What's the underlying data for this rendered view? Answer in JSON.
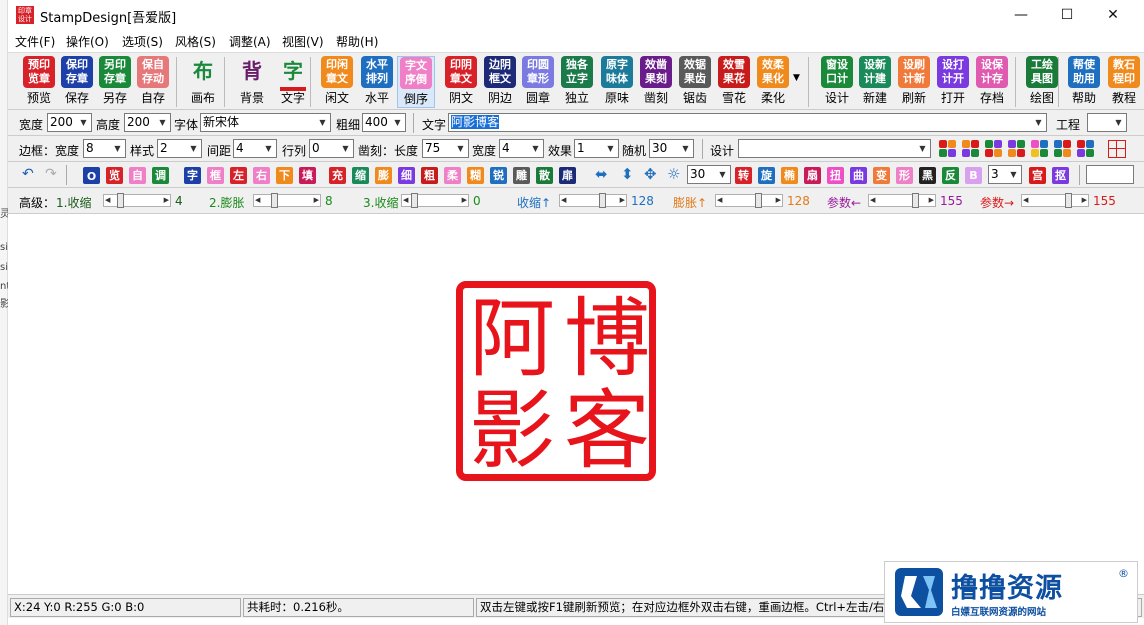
{
  "title": "StampDesign[吾爱版]",
  "icon_text": "印章设计",
  "window": {
    "minimize": "—",
    "maximize": "☐",
    "close": "✕"
  },
  "menu": [
    "文件(F)",
    "操作(O)",
    "选项(S)",
    "风格(S)",
    "调整(A)",
    "视图(V)",
    "帮助(H)"
  ],
  "toolbar": [
    {
      "icon": "预印览章",
      "label": "预览",
      "color": "#d8222a"
    },
    {
      "icon": "保印存章",
      "label": "保存",
      "color": "#1c3fa8"
    },
    {
      "icon": "另印存章",
      "label": "另存",
      "color": "#1a8a3a"
    },
    {
      "icon": "保自存动",
      "label": "自存",
      "color": "#e7787a"
    },
    {
      "icon": "布",
      "label": "画布",
      "color": "#f0f0f0"
    },
    {
      "icon": "背",
      "label": "背景",
      "color": "#f0f0f0"
    },
    {
      "icon": "字",
      "label": "文字",
      "color": "#f0f0f0"
    },
    {
      "icon": "印闲章文",
      "label": "闲文",
      "color": "#f08a1c"
    },
    {
      "icon": "水平排列",
      "label": "水平",
      "color": "#1f6fc0"
    },
    {
      "icon": "字文序倒",
      "label": "倒序",
      "color": "#ef7fc6"
    },
    {
      "icon": "印阴章文",
      "label": "阴文",
      "color": "#d8222a"
    },
    {
      "icon": "边阴框文",
      "label": "阴边",
      "color": "#1c2a78"
    },
    {
      "icon": "印圆章形",
      "label": "圆章",
      "color": "#7a7ae0"
    },
    {
      "icon": "独各立字",
      "label": "独立",
      "color": "#1a7a4a"
    },
    {
      "icon": "原字味体",
      "label": "原味",
      "color": "#1c7b9a"
    },
    {
      "icon": "效凿果刻",
      "label": "凿刻",
      "color": "#6a1c8a"
    },
    {
      "icon": "效锯果齿",
      "label": "锯齿",
      "color": "#5a5a5a"
    },
    {
      "icon": "效雪果花",
      "label": "雪花",
      "color": "#c81c1c"
    },
    {
      "icon": "效柔果化",
      "label": "柔化",
      "color": "#f08a1c"
    },
    {
      "icon": "窗设口计",
      "label": "设计",
      "color": "#1a8a3a"
    },
    {
      "icon": "设新计建",
      "label": "新建",
      "color": "#1a8a5a"
    },
    {
      "icon": "设刷计新",
      "label": "刷新",
      "color": "#f07a3a"
    },
    {
      "icon": "设打计开",
      "label": "打开",
      "color": "#7a3ae0"
    },
    {
      "icon": "设保计存",
      "label": "存档",
      "color": "#e05ab0"
    },
    {
      "icon": "工绘具图",
      "label": "绘图",
      "color": "#1a7a3a"
    },
    {
      "icon": "帮使助用",
      "label": "帮助",
      "color": "#1f6fc0"
    },
    {
      "icon": "教石程印",
      "label": "教程",
      "color": "#f08a1c"
    }
  ],
  "row1": {
    "width_label": "宽度",
    "width": "200",
    "height_label": "高度",
    "height": "200",
    "font_label": "字体",
    "font": "新宋体",
    "weight_label": "粗细",
    "weight": "400",
    "text_label": "文字",
    "text": "阿影博客",
    "project_label": "工程",
    "project": ""
  },
  "row2": {
    "border_label": "边框：宽度",
    "border_width": "8",
    "style_label": "样式",
    "style": "2",
    "spacing_label": "间距",
    "spacing": "4",
    "rowcol_label": "行列",
    "rowcol": "0",
    "carve_label": "凿刻：长度",
    "carve_len": "75",
    "carve_w_label": "宽度",
    "carve_w": "4",
    "effect_label": "效果",
    "effect": "1",
    "random_label": "随机",
    "random": "30",
    "design_label": "设计",
    "design": ""
  },
  "row3": {
    "squares": [
      {
        "t": "O",
        "c": "#1c3fa8"
      },
      {
        "t": "览",
        "c": "#d8222a"
      },
      {
        "t": "自",
        "c": "#ef7fc6"
      },
      {
        "t": "调",
        "c": "#1a8a3a"
      },
      {
        "t": "字",
        "c": "#1c3fa8"
      },
      {
        "t": "框",
        "c": "#ef7fc6"
      },
      {
        "t": "左",
        "c": "#d8222a"
      },
      {
        "t": "右",
        "c": "#ef7fc6"
      },
      {
        "t": "下",
        "c": "#f08a1c"
      },
      {
        "t": "填",
        "c": "#c81c5a"
      },
      {
        "t": "充",
        "c": "#d8222a"
      },
      {
        "t": "缩",
        "c": "#1a8a5a"
      },
      {
        "t": "膨",
        "c": "#f08a1c"
      },
      {
        "t": "细",
        "c": "#7a3ae0"
      },
      {
        "t": "粗",
        "c": "#c81c1c"
      },
      {
        "t": "柔",
        "c": "#ef7fc6"
      },
      {
        "t": "糊",
        "c": "#f08a1c"
      },
      {
        "t": "锐",
        "c": "#1f6fc0"
      },
      {
        "t": "雕",
        "c": "#5a5a5a"
      },
      {
        "t": "散",
        "c": "#1a7a3a"
      },
      {
        "t": "扉",
        "c": "#1c2a78"
      }
    ],
    "value": "30",
    "squares2": [
      {
        "t": "转",
        "c": "#d8222a"
      },
      {
        "t": "旋",
        "c": "#1f6fc0"
      },
      {
        "t": "椭",
        "c": "#f08a1c"
      },
      {
        "t": "扇",
        "c": "#c81c5a"
      },
      {
        "t": "扭",
        "c": "#ef4fc6"
      },
      {
        "t": "曲",
        "c": "#7a3ae0"
      },
      {
        "t": "变",
        "c": "#f07a3a"
      },
      {
        "t": "形",
        "c": "#ef7fc6"
      },
      {
        "t": "黑",
        "c": "#222"
      },
      {
        "t": "反",
        "c": "#1a8a3a"
      },
      {
        "t": "B",
        "c": "#d9a0ef"
      }
    ],
    "value2": "3"
  },
  "row4": {
    "label": "高级：",
    "sliders": [
      {
        "name": "1.收缩",
        "value": "4",
        "color": "#1a5a1a"
      },
      {
        "name": "2.膨胀",
        "value": "8",
        "color": "#1a8a1a"
      },
      {
        "name": "3.收缩",
        "value": "0",
        "color": "#1a8a1a"
      },
      {
        "name": "收缩↑",
        "value": "128",
        "color": "#1f6fc0"
      },
      {
        "name": "膨胀↑",
        "value": "128",
        "color": "#e07a1a"
      },
      {
        "name": "参数←",
        "value": "155",
        "color": "#9a1a9a"
      },
      {
        "name": "参数→",
        "value": "155",
        "color": "#d81a1a"
      }
    ]
  },
  "seal": [
    "博",
    "客",
    "阿",
    "影"
  ],
  "status": {
    "color": "X:24 Y:0 R:255 G:0 B:0",
    "time": "共耗时：0.216秒。",
    "hint": "双击左键或按F1键刷新预览；在对应边框外双击右键，重画边框。Ctrl+左击/右"
  },
  "watermark": {
    "title": "撸撸资源",
    "sub": "白嫖互联网资源的网站",
    "reg": "®"
  },
  "left_fragments": [
    "灵",
    "si",
    "si",
    "nt",
    "影"
  ]
}
